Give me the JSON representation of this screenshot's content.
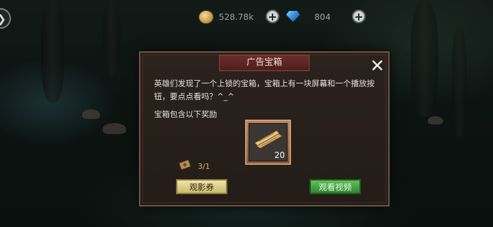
{
  "resources": {
    "gold": {
      "icon": "gold-coin-icon",
      "value": "528.78k"
    },
    "gems": {
      "icon": "gem-icon",
      "value": "804"
    }
  },
  "dialog": {
    "title": "广告宝箱",
    "description": "英雄们发现了一个上锁的宝箱，宝箱上有一块屏幕和一个播放按钮，要点点看吗？^_^",
    "contains_label": "宝箱包含以下奖励",
    "reward": {
      "icon": "wood-plank-icon",
      "count": "20"
    },
    "ticket": {
      "icon": "movie-ticket-icon",
      "count": "3/1"
    },
    "buttons": {
      "ticket": "观影券",
      "watch": "观看视频"
    }
  },
  "colors": {
    "dialog_bg": "#2b221d",
    "title_plate": "#6e2c2a",
    "ticket_button": "#e2d58e",
    "watch_button": "#4aa845",
    "ticket_count": "#d7b766"
  }
}
